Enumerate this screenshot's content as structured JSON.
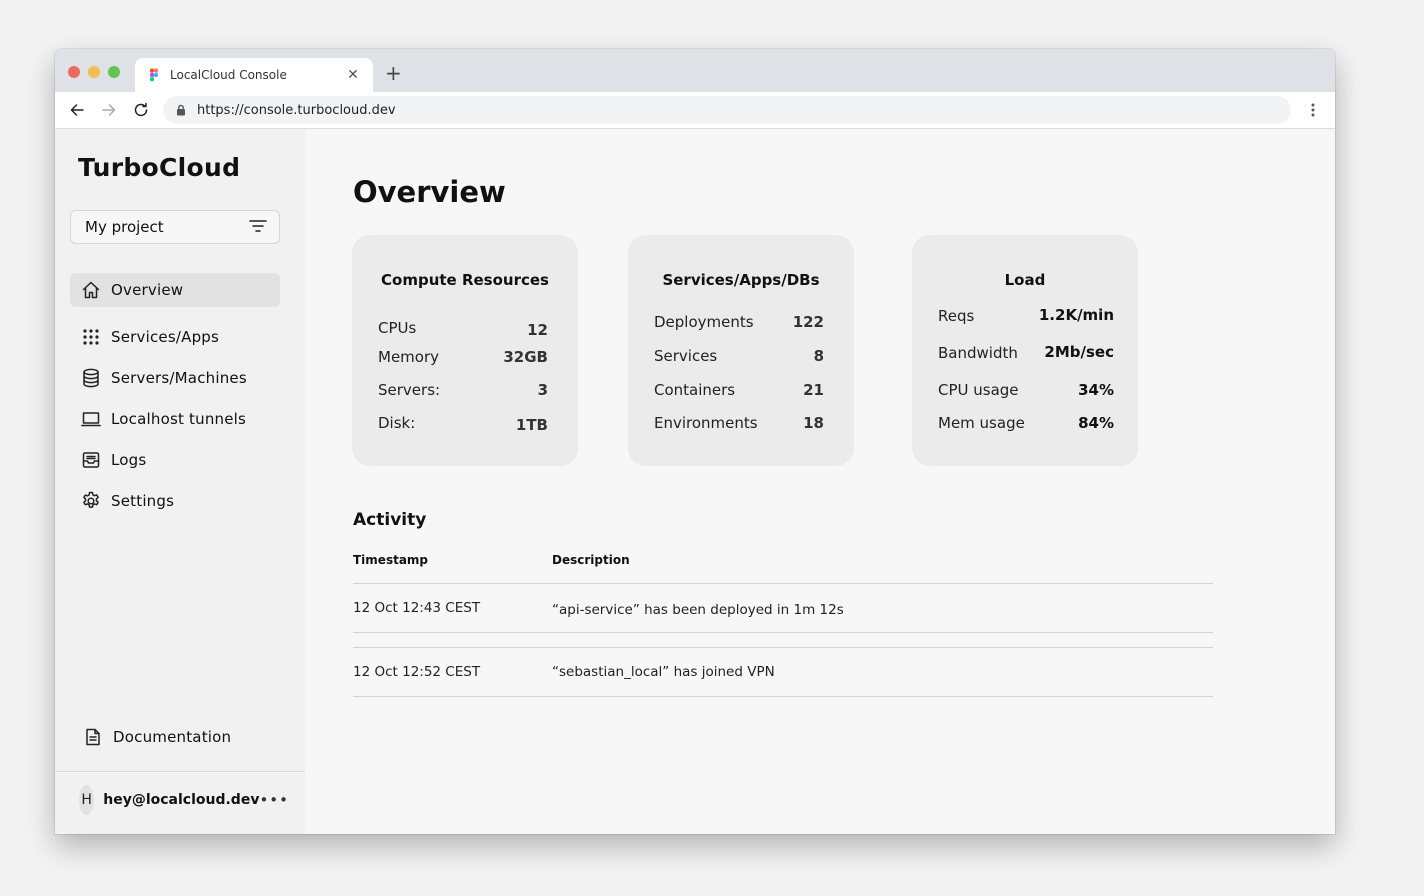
{
  "browser": {
    "tab_title": "LocalCloud Console",
    "tab_close": "✕",
    "new_tab": "+",
    "url": "https://console.turbocloud.dev"
  },
  "sidebar": {
    "brand": "TurboCloud",
    "project_select": "My project",
    "items": [
      {
        "label": "Overview",
        "icon": "home-icon",
        "active": true
      },
      {
        "label": "Services/Apps",
        "icon": "grid-dots-icon",
        "active": false
      },
      {
        "label": "Servers/Machines",
        "icon": "database-icon",
        "active": false
      },
      {
        "label": "Localhost tunnels",
        "icon": "laptop-icon",
        "active": false
      },
      {
        "label": "Logs",
        "icon": "inbox-icon",
        "active": false
      },
      {
        "label": "Settings",
        "icon": "gear-icon",
        "active": false
      }
    ],
    "documentation": "Documentation",
    "user_initial": "H",
    "user_email": "hey@localcloud.dev",
    "user_more": "•••"
  },
  "main": {
    "title": "Overview",
    "cards": [
      {
        "title": "Compute Resources",
        "metrics": [
          {
            "label": "CPUs",
            "value": "12"
          },
          {
            "label": "Memory",
            "value": "32GB"
          },
          {
            "label": "Servers:",
            "value": "3"
          },
          {
            "label": "Disk:",
            "value": "1TB"
          }
        ]
      },
      {
        "title": "Services/Apps/DBs",
        "metrics": [
          {
            "label": "Deployments",
            "value": "122"
          },
          {
            "label": "Services",
            "value": "8"
          },
          {
            "label": "Containers",
            "value": "21"
          },
          {
            "label": "Environments",
            "value": "18"
          }
        ]
      },
      {
        "title": "Load",
        "metrics": [
          {
            "label": "Reqs",
            "value": "1.2K/min"
          },
          {
            "label": "Bandwidth",
            "value": "2Mb/sec"
          },
          {
            "label": "CPU usage",
            "value": "34%"
          },
          {
            "label": "Mem usage",
            "value": "84%"
          }
        ]
      }
    ],
    "activity": {
      "title": "Activity",
      "columns": [
        "Timestamp",
        "Description"
      ],
      "rows": [
        {
          "timestamp": "12 Oct 12:43 CEST",
          "description": "“api-service” has been deployed in 1m 12s"
        },
        {
          "timestamp": "12 Oct 12:52 CEST",
          "description": "“sebastian_local” has joined VPN"
        }
      ]
    }
  }
}
